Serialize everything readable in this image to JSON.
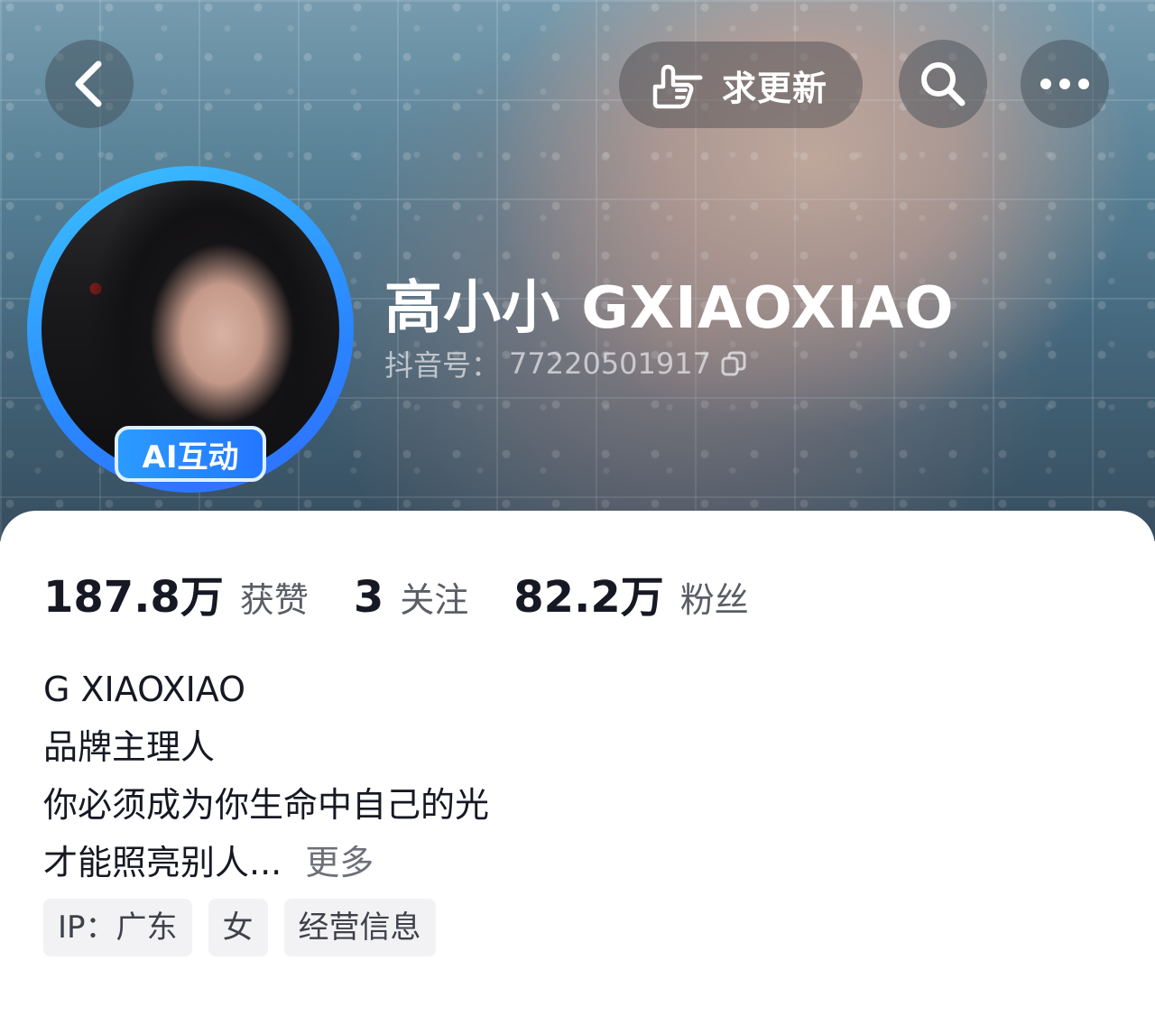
{
  "header": {
    "update_label": "求更新",
    "icons": {
      "back": "chevron-left-icon",
      "update": "pointing-hand-icon",
      "search": "search-icon",
      "more": "more-horizontal-icon"
    }
  },
  "profile": {
    "avatar_badge": "AI互动",
    "name": "高小小 GXIAOXIAO",
    "douyin_id_label": "抖音号：",
    "douyin_id": "77220501917"
  },
  "stats": [
    {
      "value": "187.8万",
      "label": "获赞"
    },
    {
      "value": "3",
      "label": "关注"
    },
    {
      "value": "82.2万",
      "label": "粉丝"
    }
  ],
  "bio": {
    "lines": [
      "G XIAOXIAO",
      "品牌主理人",
      "你必须成为你生命中自己的光",
      "才能照亮别人..."
    ],
    "more_label": "更多"
  },
  "tags": [
    "IP：广东",
    "女",
    "经营信息"
  ],
  "colors": {
    "accent_blue": "#2a88ff",
    "text_primary": "#161823",
    "text_secondary": "#5b5d66"
  }
}
